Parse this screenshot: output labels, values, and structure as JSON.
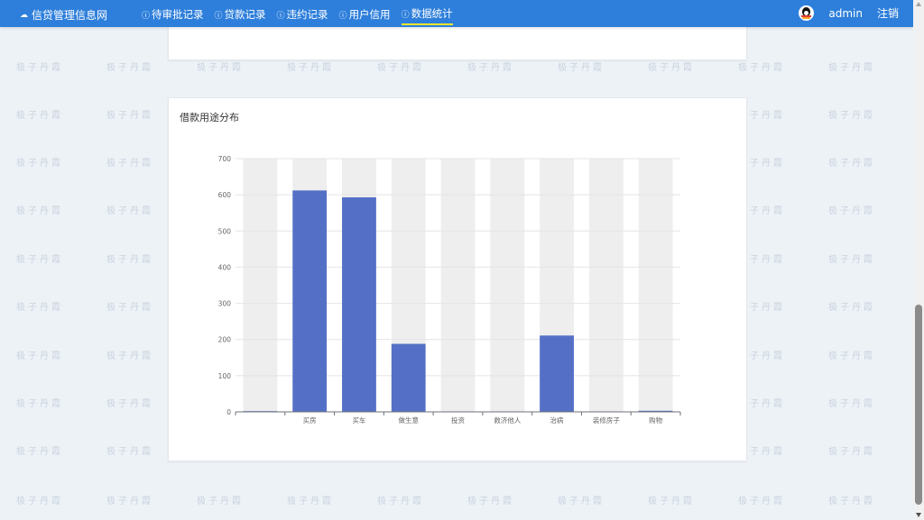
{
  "nav": {
    "brand": "信贷管理信息网",
    "items": [
      {
        "label": "待审批记录",
        "active": false
      },
      {
        "label": "贷款记录",
        "active": false
      },
      {
        "label": "违约记录",
        "active": false
      },
      {
        "label": "用户信用",
        "active": false
      },
      {
        "label": "数据统计",
        "active": true
      }
    ],
    "username": "admin",
    "logout": "注销"
  },
  "watermark_text": "极子丹霞",
  "colors": {
    "navbar": "#2e7fdb",
    "bar": "#5470c6",
    "bar_bg": "#eeeeee",
    "active_underline": "#f5e62a"
  },
  "chart_data": {
    "type": "bar",
    "title": "借款用途分布",
    "categories": [
      "",
      "买房",
      "买车",
      "做生意",
      "投资",
      "救济他人",
      "治病",
      "装修房子",
      "购物"
    ],
    "values": [
      2,
      612,
      593,
      188,
      1,
      1,
      211,
      1,
      3
    ],
    "ylim": [
      0,
      700
    ],
    "yticks": [
      0,
      100,
      200,
      300,
      400,
      500,
      600,
      700
    ],
    "background_bars": true,
    "grid": true
  }
}
